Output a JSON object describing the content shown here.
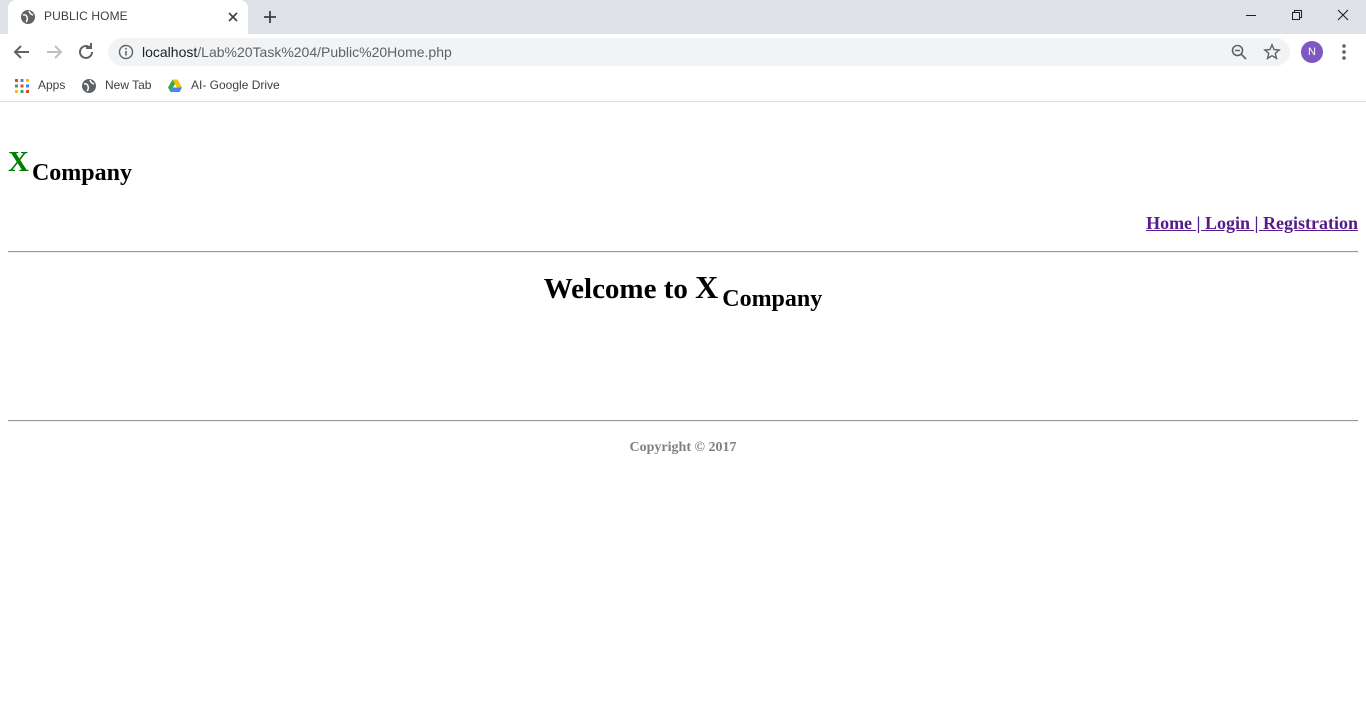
{
  "browser": {
    "tab_title": "PUBLIC HOME",
    "url_host": "localhost",
    "url_path": "/Lab%20Task%204/Public%20Home.php",
    "profile_initial": "N",
    "bookmarks": [
      {
        "label": "Apps",
        "icon": "apps-grid-icon"
      },
      {
        "label": "New Tab",
        "icon": "globe-icon"
      },
      {
        "label": "AI- Google Drive",
        "icon": "google-drive-icon"
      }
    ]
  },
  "page": {
    "logo": {
      "x": "X",
      "company": "Company"
    },
    "nav": {
      "home": "Home",
      "sep1": " | ",
      "login": "Login",
      "sep2": " | ",
      "registration": "Registration"
    },
    "welcome": {
      "text": "Welcome to ",
      "x": "X",
      "company": "Company"
    },
    "copyright": "Copyright © 2017"
  },
  "colors": {
    "logo_x": "#008000",
    "link": "#551a8b",
    "copyright": "#808080",
    "avatar": "#7e57c2"
  }
}
